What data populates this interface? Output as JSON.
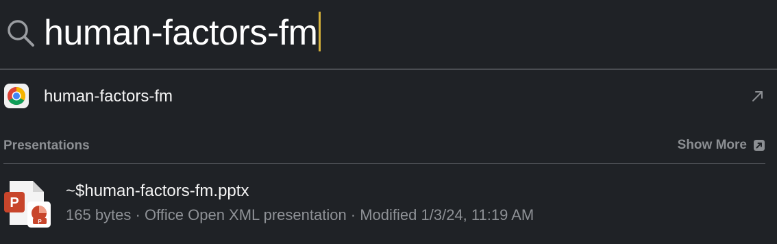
{
  "search": {
    "query": "human-factors-fm",
    "icon": "search-icon"
  },
  "top_hit": {
    "label": "human-factors-fm",
    "app_icon": "chrome-icon",
    "action_icon": "open-arrow-icon"
  },
  "section": {
    "title": "Presentations",
    "show_more_label": "Show More"
  },
  "results": [
    {
      "name": "~$human-factors-fm.pptx",
      "meta": "165 bytes · Office Open XML presentation · Modified 1/3/24, 11:19 AM",
      "icon": "powerpoint-file-icon"
    }
  ],
  "colors": {
    "background": "#1f2226",
    "caret": "#d6b23a",
    "muted_text": "#8c8f93",
    "powerpoint": "#c8452b"
  }
}
